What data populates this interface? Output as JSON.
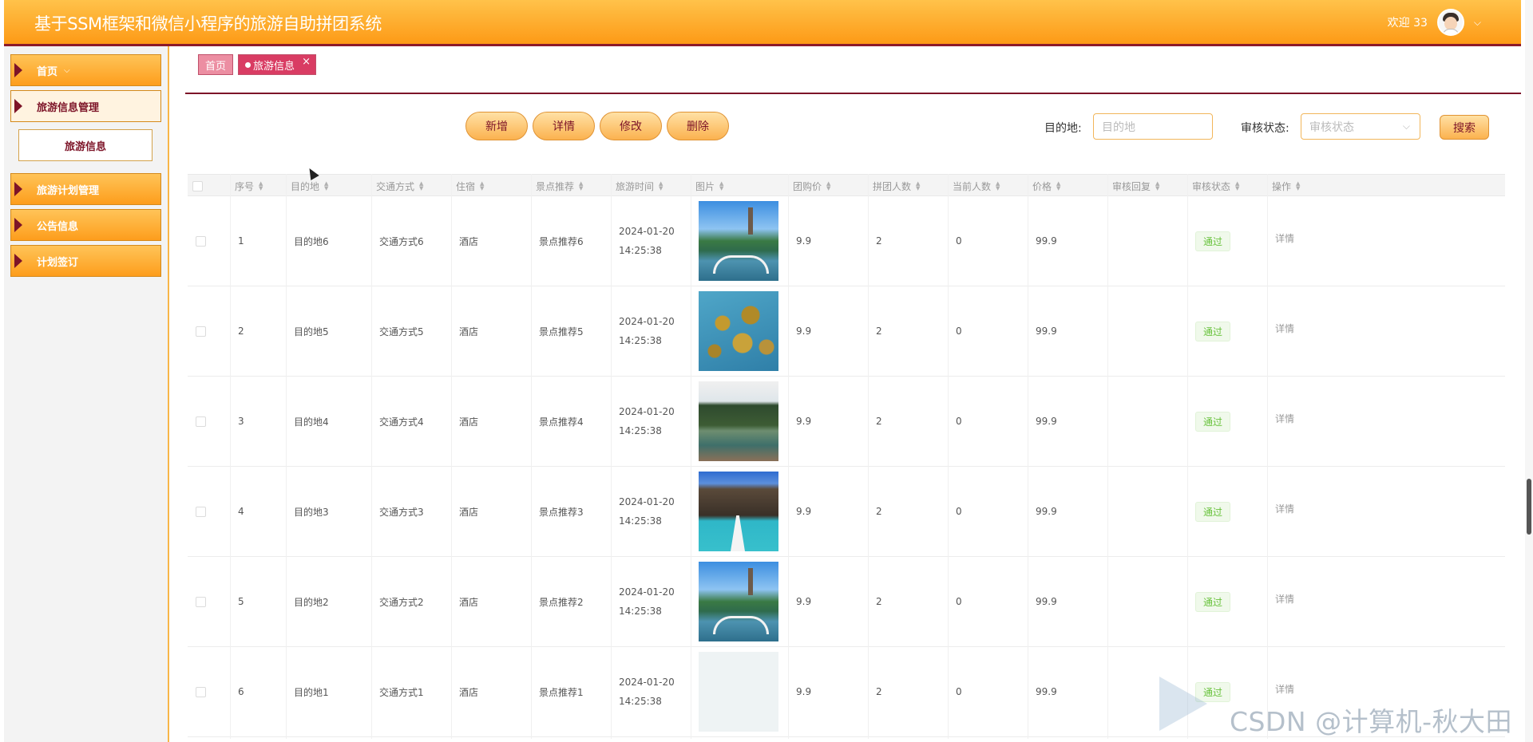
{
  "header": {
    "title": "基于SSM框架和微信小程序的旅游自助拼团系统",
    "welcome": "欢迎 33",
    "dropdown_icon": "chevron-down-icon"
  },
  "sidebar": {
    "items": [
      {
        "label": "首页",
        "has_dropdown": true
      },
      {
        "label": "旅游信息管理",
        "active": true
      },
      {
        "label": "旅游计划管理"
      },
      {
        "label": "公告信息"
      },
      {
        "label": "计划签订"
      }
    ],
    "submenu": {
      "label": "旅游信息"
    }
  },
  "tabs": [
    {
      "label": "首页"
    },
    {
      "label": "旅游信息",
      "closable": true,
      "close": "×"
    }
  ],
  "toolbar": {
    "add": "新增",
    "detail": "详情",
    "edit": "修改",
    "delete": "删除"
  },
  "filters": {
    "destination_label": "目的地:",
    "destination_placeholder": "目的地",
    "status_label": "审核状态:",
    "status_placeholder": "审核状态",
    "search": "搜索"
  },
  "table": {
    "columns": [
      "序号",
      "目的地",
      "交通方式",
      "住宿",
      "景点推荐",
      "旅游时间",
      "图片",
      "团购价",
      "拼团人数",
      "当前人数",
      "价格",
      "审核回复",
      "审核状态",
      "操作"
    ],
    "rows": [
      {
        "no": "1",
        "dest": "目的地6",
        "transport": "交通方式6",
        "stay": "酒店",
        "spot": "景点推荐6",
        "time": "2024-01-20 14:25:38",
        "img": "lake",
        "group_price": "9.9",
        "group_size": "2",
        "current": "0",
        "price": "99.9",
        "reply": "",
        "status": "通过",
        "op": "详情"
      },
      {
        "no": "2",
        "dest": "目的地5",
        "transport": "交通方式5",
        "stay": "酒店",
        "spot": "景点推荐5",
        "time": "2024-01-20 14:25:38",
        "img": "islands",
        "group_price": "9.9",
        "group_size": "2",
        "current": "0",
        "price": "99.9",
        "reply": "",
        "status": "通过",
        "op": "详情"
      },
      {
        "no": "3",
        "dest": "目的地4",
        "transport": "交通方式4",
        "stay": "酒店",
        "spot": "景点推荐4",
        "time": "2024-01-20 14:25:38",
        "img": "karst",
        "group_price": "9.9",
        "group_size": "2",
        "current": "0",
        "price": "99.9",
        "reply": "",
        "status": "通过",
        "op": "详情"
      },
      {
        "no": "4",
        "dest": "目的地3",
        "transport": "交通方式3",
        "stay": "酒店",
        "spot": "景点推荐3",
        "time": "2024-01-20 14:25:38",
        "img": "cliff",
        "group_price": "9.9",
        "group_size": "2",
        "current": "0",
        "price": "99.9",
        "reply": "",
        "status": "通过",
        "op": "详情"
      },
      {
        "no": "5",
        "dest": "目的地2",
        "transport": "交通方式2",
        "stay": "酒店",
        "spot": "景点推荐2",
        "time": "2024-01-20 14:25:38",
        "img": "lake",
        "group_price": "9.9",
        "group_size": "2",
        "current": "0",
        "price": "99.9",
        "reply": "",
        "status": "通过",
        "op": "详情"
      },
      {
        "no": "6",
        "dest": "目的地1",
        "transport": "交通方式1",
        "stay": "酒店",
        "spot": "景点推荐1",
        "time": "2024-01-20 14:25:38",
        "img": "faded",
        "group_price": "9.9",
        "group_size": "2",
        "current": "0",
        "price": "99.9",
        "reply": "",
        "status": "通过",
        "op": "详情"
      }
    ]
  },
  "watermark": "CSDN @计算机-秋大田",
  "colors": {
    "header": "#fd9a16",
    "accent": "#7d1428",
    "success": "#67c23a"
  }
}
